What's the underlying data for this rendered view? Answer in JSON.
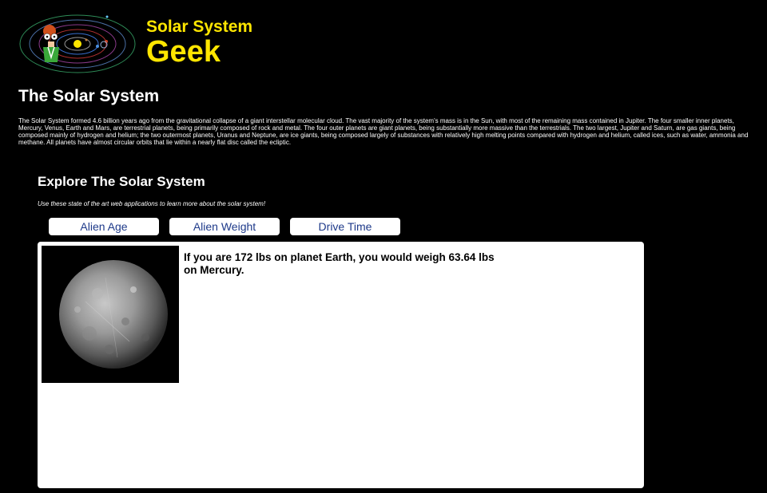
{
  "brand": {
    "line1": "Solar System",
    "line2": "Geek",
    "color": "#ffe600",
    "logo_icon": "solar-system-orbit-logo"
  },
  "page": {
    "title": "The Solar System",
    "intro": "The Solar System formed 4.6 billion years ago from the gravitational collapse of a giant interstellar molecular cloud. The vast majority of the system's mass is in the Sun, with most of the remaining mass contained in Jupiter. The four smaller inner planets, Mercury, Venus, Earth and Mars, are terrestrial planets, being primarily composed of rock and metal. The four outer planets are giant planets, being substantially more massive than the terrestrials. The two largest, Jupiter and Saturn, are gas giants, being composed mainly of hydrogen and helium; the two outermost planets, Uranus and Neptune, are ice giants, being composed largely of substances with relatively high melting points compared with hydrogen and helium, called ices, such as water, ammonia and methane. All planets have almost circular orbits that lie within a nearly flat disc called the ecliptic."
  },
  "explore": {
    "title": "Explore The Solar System",
    "subtitle": "Use these state of the art web applications to learn more about the solar system!",
    "tabs": [
      {
        "label": "Alien Age"
      },
      {
        "label": "Alien Weight"
      },
      {
        "label": "Drive Time"
      }
    ],
    "tab_text_color": "#1e3a8a"
  },
  "result": {
    "text": "If you are 172 lbs on planet Earth, you would weigh 63.64 lbs on Mercury.",
    "planet_image": "mercury-planet-image"
  }
}
